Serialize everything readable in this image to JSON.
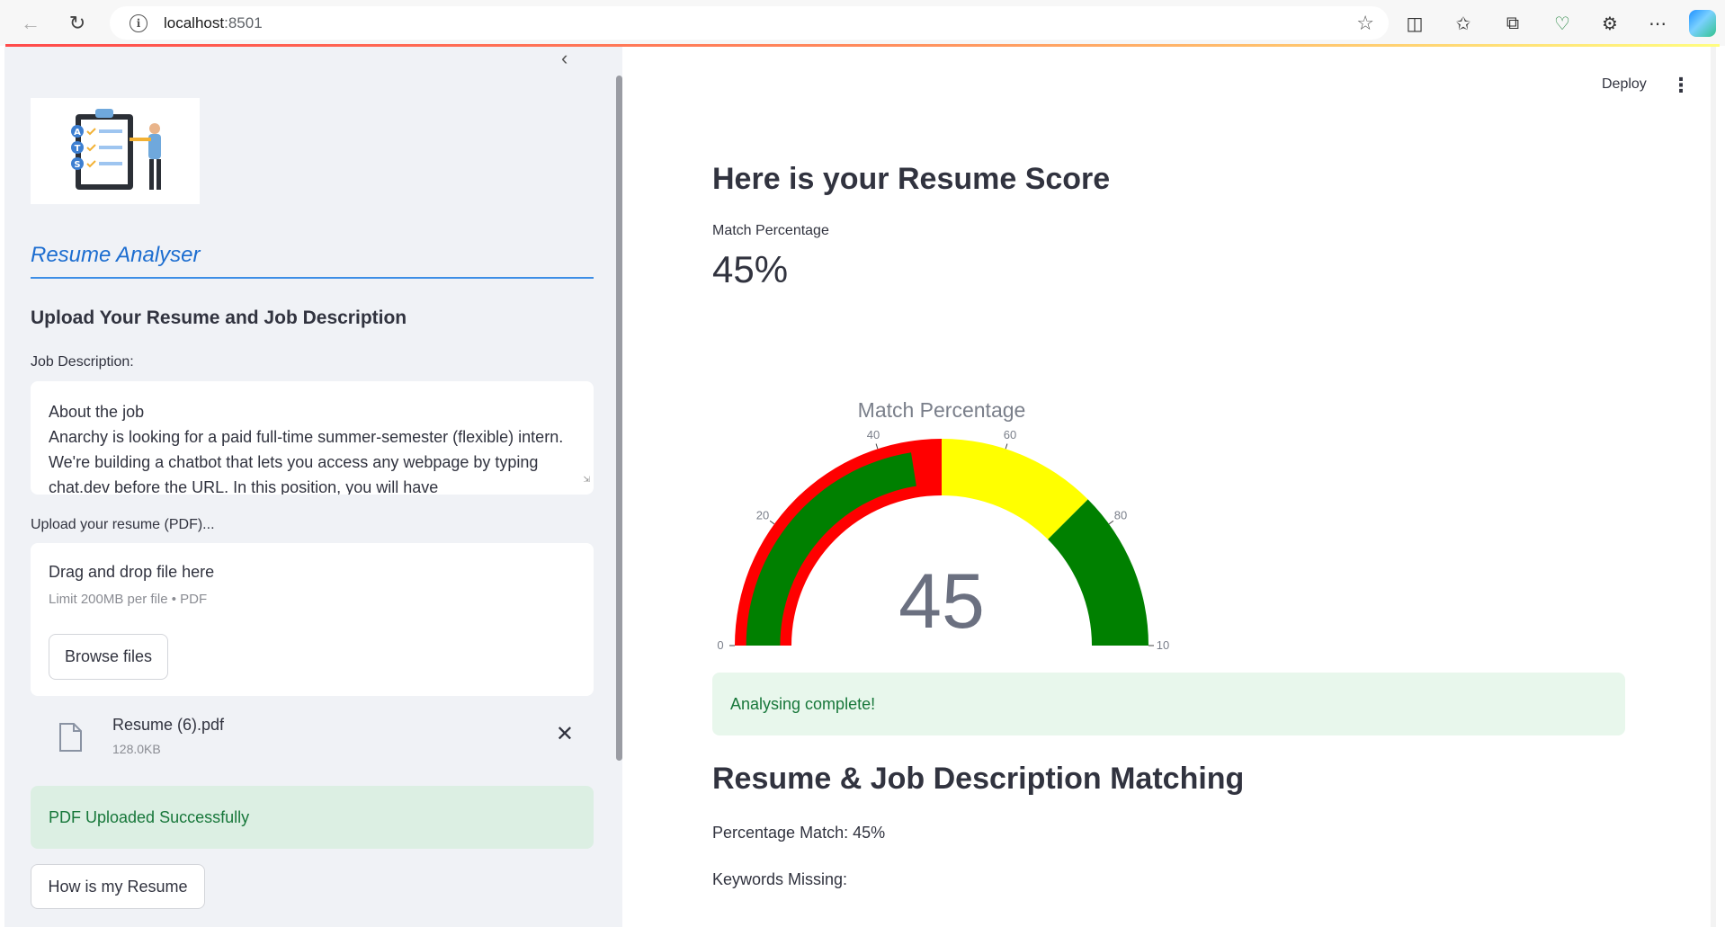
{
  "browser": {
    "url_host": "localhost",
    "url_port": ":8501",
    "icons": [
      "back-icon",
      "refresh-icon",
      "site-info-icon",
      "favorite-star-icon",
      "split-screen-icon",
      "favorites-icon",
      "collections-icon",
      "browser-essentials-icon",
      "extensions-icon",
      "more-icon",
      "copilot-icon"
    ]
  },
  "sidebar": {
    "title": "Resume Analyser",
    "heading": "Upload Your Resume and Job Description",
    "jd_label": "Job Description:",
    "jd_text": "About the job\nAnarchy is looking for a paid full-time summer-semester (flexible) intern. We're building a chatbot that lets you access any webpage by typing chat.dev before the URL. In this position, you will have",
    "upload_label": "Upload your resume (PDF)...",
    "dropzone_title": "Drag and drop file here",
    "dropzone_limit": "Limit 200MB per file • PDF",
    "browse_label": "Browse files",
    "file_name": "Resume (6).pdf",
    "file_size": "128.0KB",
    "upload_success": "PDF Uploaded Successfully",
    "action_label": "How is my Resume"
  },
  "header": {
    "deploy_label": "Deploy",
    "menu_icon": "kebab-menu-icon"
  },
  "main": {
    "score_heading": "Here is your Resume Score",
    "metric_label": "Match Percentage",
    "metric_value": "45%",
    "status_message": "Analysing complete!",
    "matching_heading": "Resume & Job Description Matching",
    "percentage_match": "Percentage Match: 45%",
    "keywords_missing": "Keywords Missing:",
    "cut_off_line": "..."
  },
  "chart_data": {
    "type": "gauge",
    "title": "Match Percentage",
    "value": 45,
    "value_label": "45",
    "range": [
      0,
      100
    ],
    "tick_labels": [
      "0",
      "20",
      "40",
      "60",
      "80",
      "10"
    ],
    "ticks": [
      0,
      20,
      40,
      60,
      80,
      100
    ],
    "steps": [
      {
        "range": [
          0,
          50
        ],
        "color": "#ff0000"
      },
      {
        "range": [
          50,
          75
        ],
        "color": "#ffff00"
      },
      {
        "range": [
          75,
          100
        ],
        "color": "#008000"
      }
    ],
    "bar_color": "#008000"
  }
}
